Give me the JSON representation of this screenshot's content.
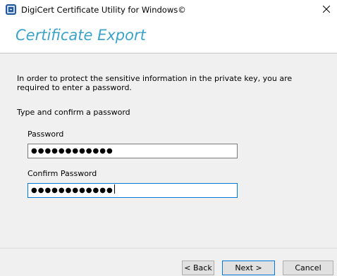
{
  "window": {
    "title": "DigiCert Certificate Utility for Windows©"
  },
  "header": {
    "title": "Certificate Export"
  },
  "content": {
    "intro": "In order to protect the sensitive information in the private key, you are required to enter a password.",
    "instruction": "Type and confirm a password",
    "password_label": "Password",
    "password_value": "●●●●●●●●●●●●",
    "confirm_label": "Confirm Password",
    "confirm_value": "●●●●●●●●●●●●"
  },
  "footer": {
    "back_label": "< Back",
    "next_label": "Next >",
    "cancel_label": "Cancel"
  },
  "colors": {
    "title_accent": "#3da2c8",
    "focus_border": "#0078d7"
  }
}
